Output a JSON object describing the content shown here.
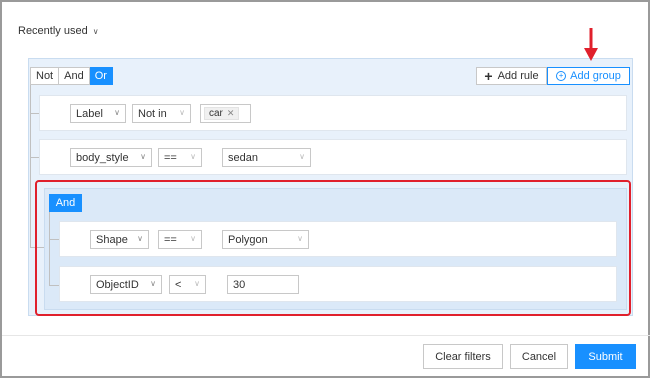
{
  "header": {
    "recently_used_label": "Recently used"
  },
  "group": {
    "conjunctions": [
      "Not",
      "And",
      "Or"
    ],
    "active_conjunction": "Or",
    "add_rule_label": "Add rule",
    "add_group_label": "Add group"
  },
  "rules": [
    {
      "field": "Label",
      "operator": "Not in",
      "value_tags": [
        "car"
      ]
    },
    {
      "field": "body_style",
      "operator": "==",
      "value": "sedan"
    }
  ],
  "subgroup": {
    "conjunction": "And",
    "rules": [
      {
        "field": "Shape",
        "operator": "==",
        "value": "Polygon"
      },
      {
        "field": "ObjectID",
        "operator": "<",
        "value": "30"
      }
    ]
  },
  "footer": {
    "clear_label": "Clear filters",
    "cancel_label": "Cancel",
    "submit_label": "Submit"
  },
  "colors": {
    "accent": "#1890ff",
    "highlight": "#e0202c",
    "arrow": "#e0202c"
  }
}
